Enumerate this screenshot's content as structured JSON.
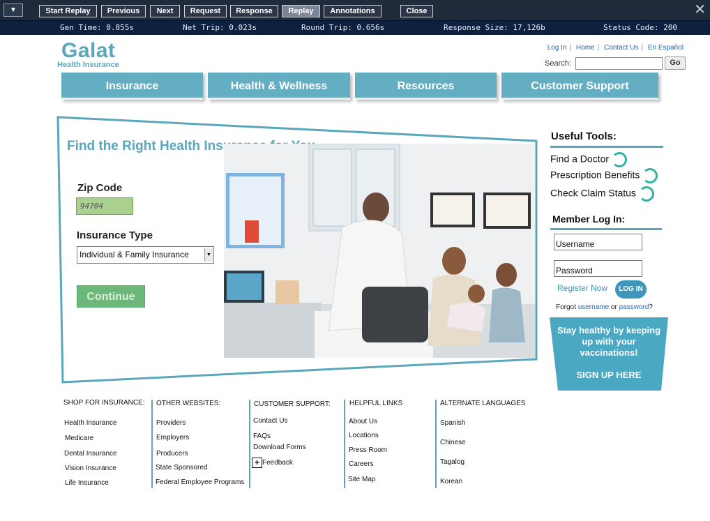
{
  "toolbar": {
    "menu_glyph": "▼",
    "buttons": [
      {
        "label": "Start Replay",
        "active": false
      },
      {
        "label": "Previous",
        "active": false
      },
      {
        "label": "Next",
        "active": false
      },
      {
        "label": "Request",
        "active": false
      },
      {
        "label": "Response",
        "active": false
      },
      {
        "label": "Replay",
        "active": true
      },
      {
        "label": "Annotations",
        "active": false
      },
      {
        "label": "Close",
        "active": false
      }
    ],
    "close_glyph": "✕"
  },
  "stats": {
    "gen_time": "Gen Time: 0.855s",
    "net_trip": "Net Trip: 0.023s",
    "round_trip": "Round Trip: 0.656s",
    "response_size": "Response Size: 17,126b",
    "status_code": "Status Code: 200"
  },
  "header": {
    "logo": "Galat",
    "logo_sub": "Health Insurance",
    "links": [
      "Log In",
      "Home",
      "Contact Us",
      "En Español"
    ],
    "search_label": "Search:",
    "search_value": "",
    "search_button": "Go"
  },
  "nav": [
    "Insurance",
    "Health & Wellness",
    "Resources",
    "Customer Support"
  ],
  "hero": {
    "title": "Find the Right Health Insurance for You",
    "zip_label": "Zip Code",
    "zip_value": "94704",
    "insurance_label": "Insurance Type",
    "insurance_value": "Individual & Family Insurance",
    "continue_label": "Continue"
  },
  "tools": {
    "title": "Useful Tools:",
    "items": [
      "Find a Doctor",
      "Prescription Benefits",
      "Check Claim Status"
    ]
  },
  "member": {
    "title": "Member Log In:",
    "username_placeholder": "Username",
    "password_placeholder": "Password",
    "register": "Register Now",
    "login_button": "LOG IN",
    "forgot_prefix": "Forgot ",
    "forgot_username": "username",
    "forgot_or": " or ",
    "forgot_password": "password",
    "forgot_suffix": "?"
  },
  "promo": {
    "text": "Stay healthy by keeping up with your vaccinations!",
    "cta": "SIGN UP HERE"
  },
  "footer": {
    "shop": {
      "title": "SHOP FOR INSURANCE:",
      "links": [
        "Health Insurance",
        "Medicare",
        "Dental Insurance",
        "Vision Insurance",
        "Life Insurance"
      ]
    },
    "other": {
      "title": "OTHER WEBSITES:",
      "links": [
        "Providers",
        "Employers",
        "Producers",
        "State Sponsored",
        "Federal Employee Programs"
      ]
    },
    "support": {
      "title": "CUSTOMER SUPPORT:",
      "links": [
        "Contact Us",
        "FAQs",
        "Download Forms",
        "Feedback"
      ]
    },
    "helpful": {
      "title": "HELPFUL LINKS",
      "links": [
        "About Us",
        "Locations",
        "Press Room",
        "Careers",
        "Site Map"
      ]
    },
    "languages": {
      "title": "ALTERNATE LANGUAGES",
      "links": [
        "Spanish",
        "Chinese",
        "Tagalog",
        "Korean"
      ]
    }
  },
  "colors": {
    "brand": "#5aa6bb",
    "nav": "#64aec3",
    "continue": "#6cb87b",
    "zip_field": "#a9d08e",
    "toolbar": "#1f2a3a",
    "stats_bar": "#0e2040"
  }
}
